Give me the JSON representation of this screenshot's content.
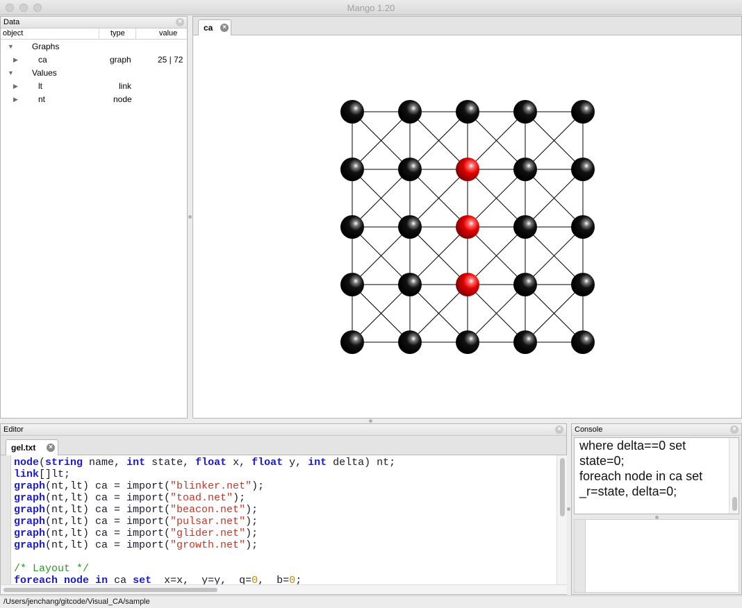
{
  "window": {
    "title": "Mango 1.20"
  },
  "data_panel": {
    "title": "Data",
    "columns": {
      "object": "object",
      "type": "type",
      "value": "value"
    },
    "groups": [
      {
        "label": "Graphs",
        "items": [
          {
            "name": "ca",
            "type": "graph",
            "value": "25 | 72"
          }
        ]
      },
      {
        "label": "Values",
        "items": [
          {
            "name": "lt",
            "type": "link",
            "value": ""
          },
          {
            "name": "nt",
            "type": "node",
            "value": ""
          }
        ]
      }
    ]
  },
  "graph_panel": {
    "tab_label": "ca",
    "grid": {
      "rows": 5,
      "cols": 5
    },
    "node_color_default": "#000000",
    "node_color_active": "#e00000",
    "active_nodes": [
      [
        1,
        2
      ],
      [
        2,
        2
      ],
      [
        3,
        2
      ]
    ]
  },
  "editor": {
    "title": "Editor",
    "tab_label": "gel.txt",
    "lines": [
      [
        {
          "t": "node",
          "c": "kw"
        },
        {
          "t": "("
        },
        {
          "t": "string",
          "c": "kw"
        },
        {
          "t": " name, "
        },
        {
          "t": "int",
          "c": "kw"
        },
        {
          "t": " state, "
        },
        {
          "t": "float",
          "c": "kw"
        },
        {
          "t": " x, "
        },
        {
          "t": "float",
          "c": "kw"
        },
        {
          "t": " y, "
        },
        {
          "t": "int",
          "c": "kw"
        },
        {
          "t": " delta) nt;"
        }
      ],
      [
        {
          "t": "link",
          "c": "kw"
        },
        {
          "t": "[]lt;"
        }
      ],
      [
        {
          "t": "graph",
          "c": "kw"
        },
        {
          "t": "(nt,lt) ca = import("
        },
        {
          "t": "\"blinker.net\"",
          "c": "str"
        },
        {
          "t": ");"
        }
      ],
      [
        {
          "t": "graph",
          "c": "kw"
        },
        {
          "t": "(nt,lt) ca = import("
        },
        {
          "t": "\"toad.net\"",
          "c": "str"
        },
        {
          "t": ");"
        }
      ],
      [
        {
          "t": "graph",
          "c": "kw"
        },
        {
          "t": "(nt,lt) ca = import("
        },
        {
          "t": "\"beacon.net\"",
          "c": "str"
        },
        {
          "t": ");"
        }
      ],
      [
        {
          "t": "graph",
          "c": "kw"
        },
        {
          "t": "(nt,lt) ca = import("
        },
        {
          "t": "\"pulsar.net\"",
          "c": "str"
        },
        {
          "t": ");"
        }
      ],
      [
        {
          "t": "graph",
          "c": "kw"
        },
        {
          "t": "(nt,lt) ca = import("
        },
        {
          "t": "\"glider.net\"",
          "c": "str"
        },
        {
          "t": ");"
        }
      ],
      [
        {
          "t": "graph",
          "c": "kw"
        },
        {
          "t": "(nt,lt) ca = import("
        },
        {
          "t": "\"growth.net\"",
          "c": "str"
        },
        {
          "t": ");"
        }
      ],
      [
        {
          "t": ""
        }
      ],
      [
        {
          "t": "/* Layout */",
          "c": "cmt"
        }
      ],
      [
        {
          "t": "foreach",
          "c": "kw"
        },
        {
          "t": " "
        },
        {
          "t": "node",
          "c": "kw"
        },
        {
          "t": " "
        },
        {
          "t": "in",
          "c": "kw"
        },
        {
          "t": " ca "
        },
        {
          "t": "set",
          "c": "kw"
        },
        {
          "t": "  x=x,  y=y,  q="
        },
        {
          "t": "0",
          "c": "num"
        },
        {
          "t": ",  b="
        },
        {
          "t": "0",
          "c": "num"
        },
        {
          "t": ";"
        }
      ]
    ]
  },
  "console": {
    "title": "Console",
    "output_lines": [
      "where delta==0 set",
      "state=0;",
      "foreach node in ca set",
      "_r=state, delta=0;"
    ]
  },
  "status_bar": {
    "path": "/Users/jenchang/gitcode/Visual_CA/sample"
  }
}
